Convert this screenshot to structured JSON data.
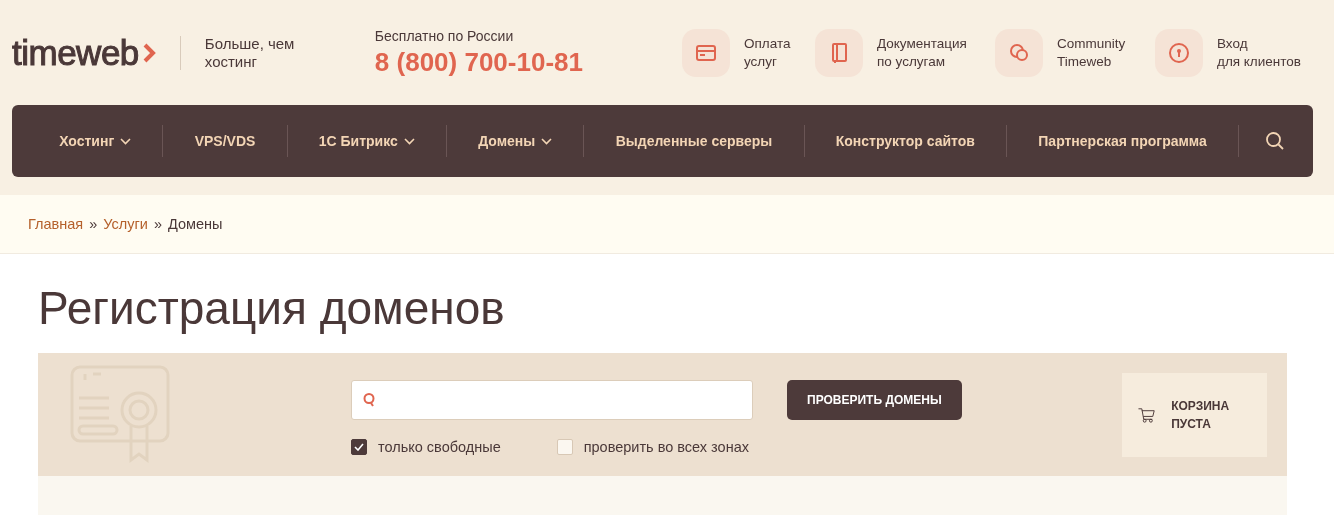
{
  "header": {
    "logo": "timeweb",
    "tagline": "Больше, чем хостинг",
    "phone_caption": "Бесплатно по России",
    "phone": "8 (800) 700-10-81",
    "links": [
      {
        "kind": "card",
        "label": "Оплата\nуслуг"
      },
      {
        "kind": "book",
        "label": "Документация\nпо услугам"
      },
      {
        "kind": "chat",
        "label": "Community\nTimeweb"
      },
      {
        "kind": "lock",
        "label": "Вход\nдля клиентов"
      }
    ]
  },
  "nav": {
    "items": [
      {
        "label": "Хостинг",
        "has_menu": true
      },
      {
        "label": "VPS/VDS",
        "has_menu": false
      },
      {
        "label": "1С Битрикс",
        "has_menu": true
      },
      {
        "label": "Домены",
        "has_menu": true
      },
      {
        "label": "Выделенные серверы",
        "has_menu": false
      },
      {
        "label": "Конструктор сайтов",
        "has_menu": false
      },
      {
        "label": "Партнерская программа",
        "has_menu": false
      }
    ]
  },
  "breadcrumbs": [
    {
      "kind": "crumb",
      "label": "Главная",
      "link": true
    },
    {
      "kind": "separator",
      "label": "»"
    },
    {
      "kind": "crumb",
      "label": "Услуги",
      "link": true
    },
    {
      "kind": "separator",
      "label": "»"
    },
    {
      "kind": "crumb",
      "label": "Домены",
      "link": false
    }
  ],
  "title": "Регистрация доменов",
  "domain_search": {
    "button": "ПРОВЕРИТЬ ДОМЕНЫ",
    "options": [
      {
        "label": "только свободные",
        "checked": true
      },
      {
        "label": "проверить во всех зонах",
        "checked": false
      }
    ],
    "cart": "КОРЗИНА ПУСТА"
  }
}
